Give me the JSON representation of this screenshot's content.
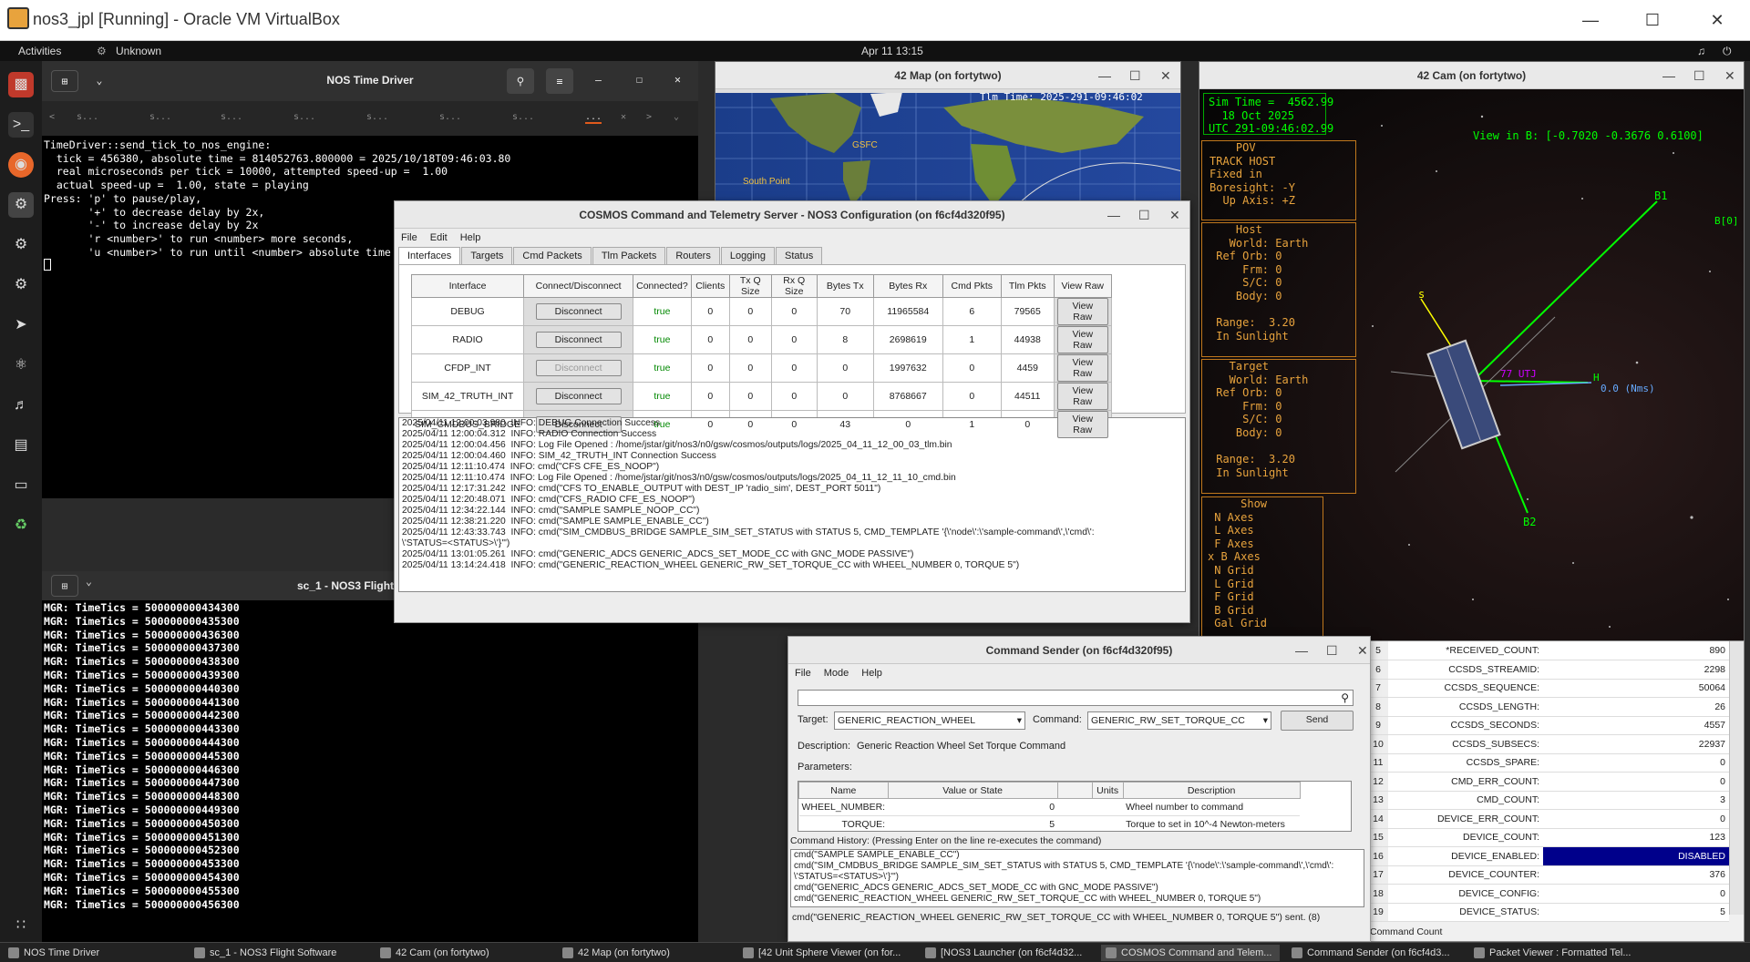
{
  "vbox": {
    "title": "nos3_jpl [Running] - Oracle VM VirtualBox"
  },
  "topbar": {
    "activities": "Activities",
    "network": "Unknown",
    "clock": "Apr 11  13:15"
  },
  "time_driver": {
    "title": "NOS Time Driver",
    "tabs": [
      "s...",
      "s...",
      "s...",
      "s...",
      "s...",
      "s...",
      "s...",
      "..."
    ],
    "lines": [
      "TimeDriver::send_tick_to_nos_engine:",
      "  tick = 456380, absolute time = 814052763.800000 = 2025/10/18T09:46:03.80",
      "  real microseconds per tick = 10000, attempted speed-up =  1.00",
      "  actual speed-up =  1.00, state = playing",
      "",
      "Press: 'p' to pause/play,",
      "       '+' to decrease delay by 2x,",
      "       '-' to increase delay by 2x",
      "       'r <number>' to run <number> more seconds,",
      "       'u <number>' to run until <number> absolute time"
    ]
  },
  "flight": {
    "title": "sc_1 - NOS3 Flight",
    "lines": [
      "MGR: TimeTics = 500000000434300",
      "MGR: TimeTics = 500000000435300",
      "MGR: TimeTics = 500000000436300",
      "MGR: TimeTics = 500000000437300",
      "MGR: TimeTics = 500000000438300",
      "MGR: TimeTics = 500000000439300",
      "MGR: TimeTics = 500000000440300",
      "MGR: TimeTics = 500000000441300",
      "MGR: TimeTics = 500000000442300",
      "MGR: TimeTics = 500000000443300",
      "MGR: TimeTics = 500000000444300",
      "MGR: TimeTics = 500000000445300",
      "MGR: TimeTics = 500000000446300",
      "MGR: TimeTics = 500000000447300",
      "MGR: TimeTics = 500000000448300",
      "MGR: TimeTics = 500000000449300",
      "MGR: TimeTics = 500000000450300",
      "MGR: TimeTics = 500000000451300",
      "MGR: TimeTics = 500000000452300",
      "MGR: TimeTics = 500000000453300",
      "MGR: TimeTics = 500000000454300",
      "MGR: TimeTics = 500000000455300",
      "MGR: TimeTics = 500000000456300"
    ]
  },
  "map42": {
    "title": "42 Map (on fortytwo)",
    "tlm_time": "Tlm Time:  2025-291-09:46:02",
    "gsfc": "GSFC",
    "south": "South Point"
  },
  "cam42": {
    "title": "42 Cam (on fortytwo)",
    "sim_time": "Sim Time =  4562.99",
    "date": "  18 Oct 2025",
    "utc": "UTC 291-09:46:02.99",
    "view": "View in B: [-0.7020 -0.3676  0.6100]",
    "pov": "    POV\nTRACK HOST\nFixed in\nBoresight: -Y\n  Up Axis: +Z",
    "host": "    Host\n   World: Earth\n Ref Orb: 0\n     Frm: 0\n     S/C: 0\n    Body: 0\n\n Range:  3.20\n In Sunlight",
    "target": "   Target\n   World: Earth\n Ref Orb: 0\n     Frm: 0\n     S/C: 0\n    Body: 0\n\n Range:  3.20\n In Sunlight",
    "show": "     Show\n N Axes\n L Axes\n F Axes\nx B Axes\n N Grid\n L Grid\n F Grid\n B Grid\n Gal Grid",
    "b1": "B1",
    "b2": "B2",
    "b3": "B[0]",
    "s": "s",
    "h": "H",
    "h2": "0.0 (Nms)",
    "l": "77  UTJ"
  },
  "cosmos": {
    "title": "COSMOS Command and Telemetry Server - NOS3 Configuration (on f6cf4d320f95)",
    "menu": [
      "File",
      "Edit",
      "Help"
    ],
    "tabs": [
      "Interfaces",
      "Targets",
      "Cmd Packets",
      "Tlm Packets",
      "Routers",
      "Logging",
      "Status"
    ],
    "headers": [
      "Interface",
      "Connect/Disconnect",
      "Connected?",
      "Clients",
      "Tx Q Size",
      "Rx Q Size",
      "Bytes Tx",
      "Bytes Rx",
      "Cmd Pkts",
      "Tlm Pkts",
      "View Raw"
    ],
    "rows": [
      [
        "DEBUG",
        "Disconnect",
        "true",
        "0",
        "0",
        "0",
        "70",
        "11965584",
        "6",
        "79565",
        "View Raw"
      ],
      [
        "RADIO",
        "Disconnect",
        "true",
        "0",
        "0",
        "0",
        "8",
        "2698619",
        "1",
        "44938",
        "View Raw"
      ],
      [
        "CFDP_INT",
        "Disconnect",
        "true",
        "0",
        "0",
        "0",
        "0",
        "1997632",
        "0",
        "4459",
        "View Raw"
      ],
      [
        "SIM_42_TRUTH_INT",
        "Disconnect",
        "true",
        "0",
        "0",
        "0",
        "0",
        "8768667",
        "0",
        "44511",
        "View Raw"
      ],
      [
        "SIM_CMDBUS_BRIDGE",
        "Disconnect",
        "true",
        "0",
        "0",
        "0",
        "43",
        "0",
        "1",
        "0",
        "View Raw"
      ]
    ],
    "log": [
      "2025/04/11 12:00:03.980  INFO: DEBUG Connection Success",
      "2025/04/11 12:00:04.312  INFO: RADIO Connection Success",
      "2025/04/11 12:00:04.456  INFO: Log File Opened : /home/jstar/git/nos3/n0/gsw/cosmos/outputs/logs/2025_04_11_12_00_03_tlm.bin",
      "2025/04/11 12:00:04.460  INFO: SIM_42_TRUTH_INT Connection Success",
      "2025/04/11 12:11:10.474  INFO: cmd(\"CFS CFE_ES_NOOP\")",
      "2025/04/11 12:11:10.474  INFO: Log File Opened : /home/jstar/git/nos3/n0/gsw/cosmos/outputs/logs/2025_04_11_12_11_10_cmd.bin",
      "2025/04/11 12:17:31.242  INFO: cmd(\"CFS TO_ENABLE_OUTPUT with DEST_IP 'radio_sim', DEST_PORT 5011\")",
      "2025/04/11 12:20:48.071  INFO: cmd(\"CFS_RADIO CFE_ES_NOOP\")",
      "2025/04/11 12:34:22.144  INFO: cmd(\"SAMPLE SAMPLE_NOOP_CC\")",
      "2025/04/11 12:38:21.220  INFO: cmd(\"SAMPLE SAMPLE_ENABLE_CC\")",
      "2025/04/11 12:43:33.743  INFO: cmd(\"SIM_CMDBUS_BRIDGE SAMPLE_SIM_SET_STATUS with STATUS 5, CMD_TEMPLATE '{\\'node\\':\\'sample-command\\',\\'cmd\\':",
      "\\'STATUS=<STATUS>\\'}'\")",
      "2025/04/11 13:01:05.261  INFO: cmd(\"GENERIC_ADCS GENERIC_ADCS_SET_MODE_CC with GNC_MODE PASSIVE\")",
      "2025/04/11 13:14:24.418  INFO: cmd(\"GENERIC_REACTION_WHEEL GENERIC_RW_SET_TORQUE_CC with WHEEL_NUMBER 0, TORQUE 5\")"
    ]
  },
  "sender": {
    "title": "Command Sender (on f6cf4d320f95)",
    "menu": [
      "File",
      "Mode",
      "Help"
    ],
    "target_label": "Target:",
    "target": "GENERIC_REACTION_WHEEL",
    "command_label": "Command:",
    "command": "GENERIC_RW_SET_TORQUE_CC",
    "send": "Send",
    "desc_label": "Description:",
    "desc": "Generic Reaction Wheel Set Torque Command",
    "params_label": "Parameters:",
    "param_headers": [
      "Name",
      "Value or State",
      "",
      "Units",
      "Description"
    ],
    "params": [
      [
        "WHEEL_NUMBER:",
        "0",
        "",
        "",
        "Wheel number to command"
      ],
      [
        "TORQUE:",
        "5",
        "",
        "",
        "Torque to set in 10^-4 Newton-meters"
      ]
    ],
    "history_label": "Command History: (Pressing Enter on the line re-executes the command)",
    "history": [
      "cmd(\"SAMPLE SAMPLE_ENABLE_CC\")",
      "cmd(\"SIM_CMDBUS_BRIDGE SAMPLE_SIM_SET_STATUS with STATUS 5, CMD_TEMPLATE '{\\'node\\':\\'sample-command\\',\\'cmd\\':",
      "\\'STATUS=<STATUS>\\'}'\")",
      "cmd(\"GENERIC_ADCS GENERIC_ADCS_SET_MODE_CC with GNC_MODE PASSIVE\")",
      "cmd(\"GENERIC_REACTION_WHEEL GENERIC_RW_SET_TORQUE_CC with WHEEL_NUMBER 0, TORQUE 5\")"
    ],
    "status": "cmd(\"GENERIC_REACTION_WHEEL GENERIC_RW_SET_TORQUE_CC with WHEEL_NUMBER 0, TORQUE 5\") sent. (8)"
  },
  "packet": {
    "rows": [
      [
        "5",
        "*RECEIVED_COUNT:",
        "890"
      ],
      [
        "6",
        "CCSDS_STREAMID:",
        "2298"
      ],
      [
        "7",
        "CCSDS_SEQUENCE:",
        "50064"
      ],
      [
        "8",
        "CCSDS_LENGTH:",
        "26"
      ],
      [
        "9",
        "CCSDS_SECONDS:",
        "4557"
      ],
      [
        "10",
        "CCSDS_SUBSECS:",
        "22937"
      ],
      [
        "11",
        "CCSDS_SPARE:",
        "0"
      ],
      [
        "12",
        "CMD_ERR_COUNT:",
        "0"
      ],
      [
        "13",
        "CMD_COUNT:",
        "3"
      ],
      [
        "14",
        "DEVICE_ERR_COUNT:",
        "0"
      ],
      [
        "15",
        "DEVICE_COUNT:",
        "123"
      ],
      [
        "16",
        "DEVICE_ENABLED:",
        "DISABLED"
      ],
      [
        "17",
        "DEVICE_COUNTER:",
        "376"
      ],
      [
        "18",
        "DEVICE_CONFIG:",
        "0"
      ],
      [
        "19",
        "DEVICE_STATUS:",
        "5"
      ]
    ],
    "footer": "Command Count"
  },
  "taskbar": [
    {
      "label": "NOS Time Driver"
    },
    {
      "label": "sc_1 - NOS3 Flight Software"
    },
    {
      "label": "42 Cam (on fortytwo)"
    },
    {
      "label": "42 Map (on fortytwo)"
    },
    {
      "label": "[42 Unit Sphere Viewer (on for..."
    },
    {
      "label": "[NOS3 Launcher (on f6cf4d32..."
    },
    {
      "label": "COSMOS Command and Telem..."
    },
    {
      "label": "Command Sender (on f6cf4d3..."
    },
    {
      "label": "Packet Viewer : Formatted Tel..."
    }
  ]
}
